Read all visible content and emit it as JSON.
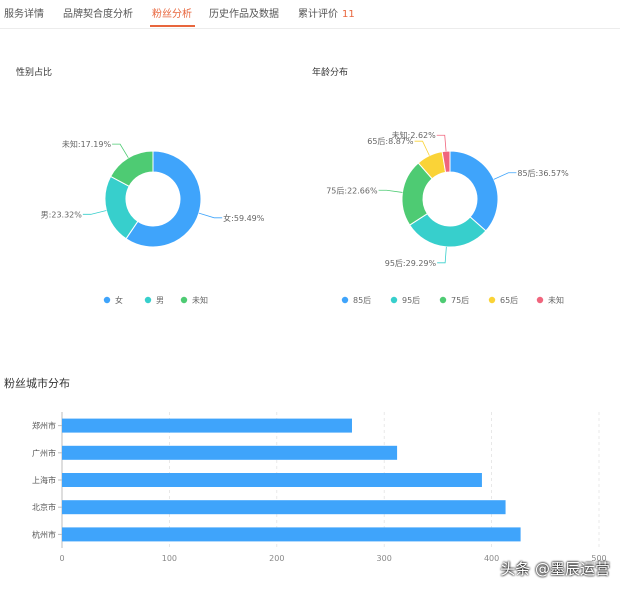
{
  "tabs": [
    {
      "label": "服务详情",
      "active": false
    },
    {
      "label": "品牌契合度分析",
      "active": false
    },
    {
      "label": "粉丝分析",
      "active": true
    },
    {
      "label": "历史作品及数据",
      "active": false
    },
    {
      "label": "累计评价",
      "count": "11",
      "active": false
    }
  ],
  "colors": {
    "accent": "#e8663d",
    "blue": "#3fa4fb",
    "teal": "#37cfcc",
    "green": "#4ecb73",
    "yellow": "#fad337",
    "red": "#f0657d"
  },
  "watermark": "头条 @墨辰运营",
  "chart_data": [
    {
      "type": "pie",
      "title": "性别占比",
      "donut": true,
      "legend_position": "bottom",
      "slices": [
        {
          "name": "女",
          "value": 59.49,
          "label": "女:59.49%",
          "color": "#3fa4fb"
        },
        {
          "name": "男",
          "value": 23.32,
          "label": "男:23.32%",
          "color": "#37cfcc"
        },
        {
          "name": "未知",
          "value": 17.19,
          "label": "未知:17.19%",
          "color": "#4ecb73"
        }
      ]
    },
    {
      "type": "pie",
      "title": "年龄分布",
      "donut": true,
      "legend_position": "bottom",
      "slices": [
        {
          "name": "85后",
          "value": 36.57,
          "label": "85后:36.57%",
          "color": "#3fa4fb"
        },
        {
          "name": "95后",
          "value": 29.29,
          "label": "95后:29.29%",
          "color": "#37cfcc"
        },
        {
          "name": "75后",
          "value": 22.66,
          "label": "75后:22.66%",
          "color": "#4ecb73"
        },
        {
          "name": "65后",
          "value": 8.87,
          "label": "65后:8.87%",
          "color": "#fad337"
        },
        {
          "name": "未知",
          "value": 2.62,
          "label": "未知:2.62%",
          "color": "#f0657d"
        }
      ]
    },
    {
      "type": "bar",
      "orientation": "horizontal",
      "title": "粉丝城市分布",
      "categories": [
        "郑州市",
        "广州市",
        "上海市",
        "北京市",
        "杭州市"
      ],
      "values": [
        270,
        312,
        391,
        413,
        427
      ],
      "color": "#3fa4fb",
      "xlim": [
        0,
        500
      ],
      "xticks": [
        0,
        100,
        200,
        300,
        400,
        500
      ],
      "grid": true
    }
  ]
}
